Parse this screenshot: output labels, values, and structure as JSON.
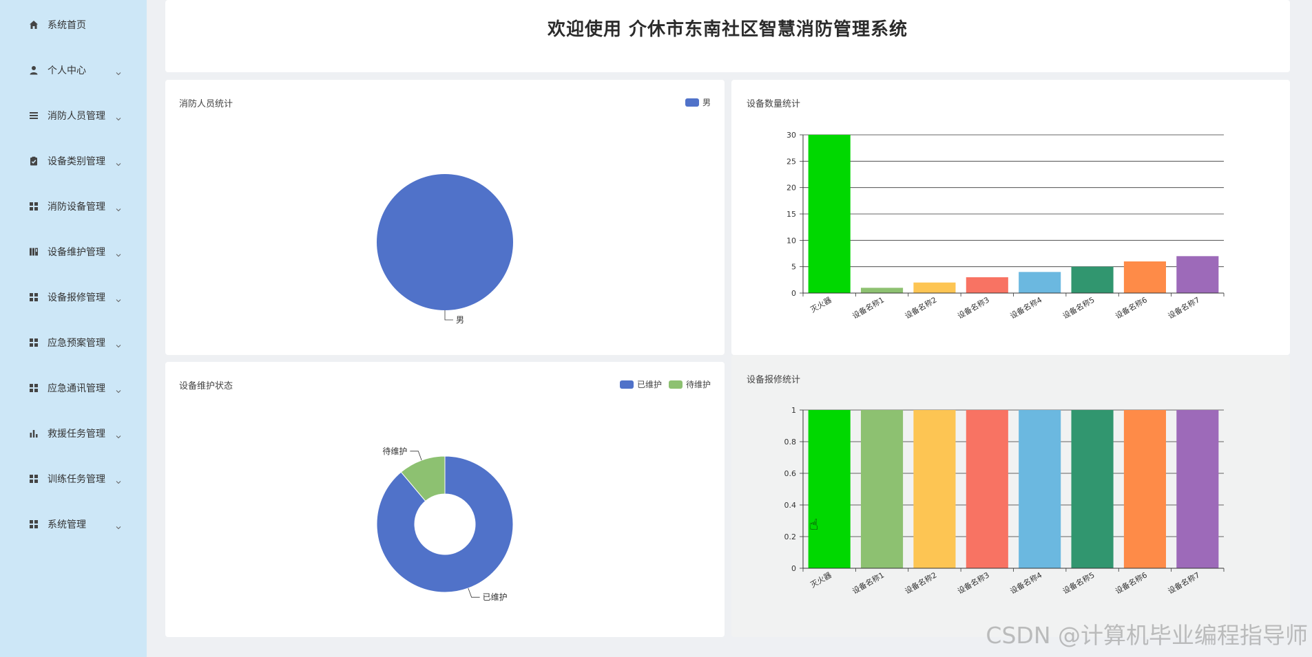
{
  "sidebar": {
    "items": [
      {
        "label": "系统首页",
        "icon": "home-icon",
        "has_submenu": false
      },
      {
        "label": "个人中心",
        "icon": "user-icon",
        "has_submenu": true
      },
      {
        "label": "消防人员管理",
        "icon": "list-icon",
        "has_submenu": true
      },
      {
        "label": "设备类别管理",
        "icon": "clipboard-icon",
        "has_submenu": true
      },
      {
        "label": "消防设备管理",
        "icon": "grid-icon",
        "has_submenu": true
      },
      {
        "label": "设备维护管理",
        "icon": "book-icon",
        "has_submenu": true
      },
      {
        "label": "设备报修管理",
        "icon": "grid-icon",
        "has_submenu": true
      },
      {
        "label": "应急预案管理",
        "icon": "grid-icon",
        "has_submenu": true
      },
      {
        "label": "应急通讯管理",
        "icon": "grid-icon",
        "has_submenu": true
      },
      {
        "label": "救援任务管理",
        "icon": "bar-chart-icon",
        "has_submenu": true
      },
      {
        "label": "训练任务管理",
        "icon": "grid-icon",
        "has_submenu": true
      },
      {
        "label": "系统管理",
        "icon": "grid-icon",
        "has_submenu": true
      }
    ]
  },
  "header": {
    "title": "欢迎使用 介休市东南社区智慧消防管理系统"
  },
  "watermark": "CSDN @计算机毕业编程指导师",
  "colors": {
    "sidebar_bg": "#cde7f7",
    "palette": [
      "#00d800",
      "#8dc171",
      "#fdc553",
      "#f87363",
      "#6bb8e0",
      "#31966f",
      "#fe8b48",
      "#9d6ab9"
    ],
    "pie_blue": "#5072c9",
    "pie_green": "#8dc171"
  },
  "chart_data": [
    {
      "type": "pie",
      "title": "消防人员统计",
      "legend": [
        "男"
      ],
      "slices": [
        {
          "name": "男",
          "value": 1
        }
      ]
    },
    {
      "type": "bar",
      "title": "设备数量统计",
      "categories": [
        "灭火器",
        "设备名称1",
        "设备名称2",
        "设备名称3",
        "设备名称4",
        "设备名称5",
        "设备名称6",
        "设备名称7"
      ],
      "values": [
        30,
        1,
        2,
        3,
        4,
        5,
        6,
        7
      ],
      "ylim": [
        0,
        30
      ],
      "yticks": [
        "0",
        "5",
        "10",
        "15",
        "20",
        "25",
        "30"
      ]
    },
    {
      "type": "pie",
      "title": "设备维护状态",
      "legend": [
        "已维护",
        "待维护"
      ],
      "slices": [
        {
          "name": "已维护",
          "value": 8
        },
        {
          "name": "待维护",
          "value": 1
        }
      ]
    },
    {
      "type": "bar",
      "title": "设备报修统计",
      "categories": [
        "灭火器",
        "设备名称1",
        "设备名称2",
        "设备名称3",
        "设备名称4",
        "设备名称5",
        "设备名称6",
        "设备名称7"
      ],
      "values": [
        1,
        1,
        1,
        1,
        1,
        1,
        1,
        1
      ],
      "ylim": [
        0,
        1
      ],
      "yticks": [
        "0",
        "0.2",
        "0.4",
        "0.6",
        "0.8",
        "1"
      ]
    }
  ]
}
